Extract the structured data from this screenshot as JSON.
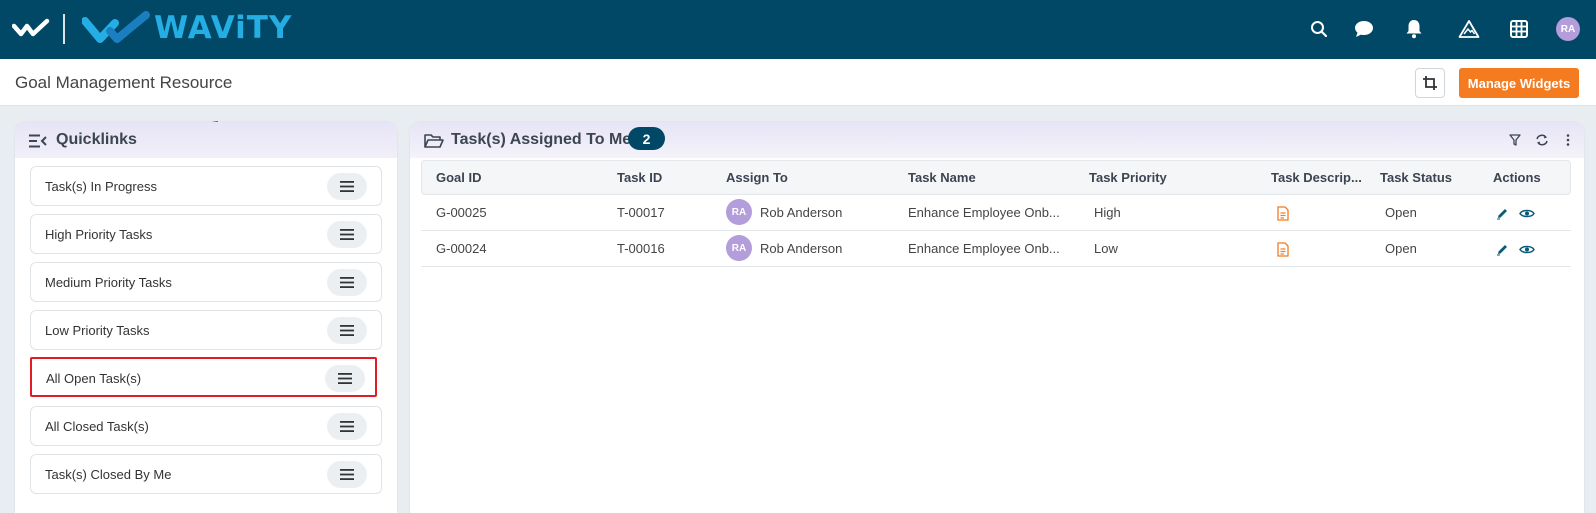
{
  "brand": {
    "name": "WAViTY"
  },
  "header": {
    "user_initials": "RA"
  },
  "page": {
    "title": "Goal Management Resource",
    "manage_widgets_label": "Manage Widgets"
  },
  "quicklinks": {
    "title": "Quicklinks",
    "items": [
      {
        "label": "Task(s) In Progress"
      },
      {
        "label": "High Priority Tasks"
      },
      {
        "label": "Medium Priority Tasks"
      },
      {
        "label": "Low Priority Tasks"
      },
      {
        "label": "All Open Task(s)"
      },
      {
        "label": "All Closed Task(s)"
      },
      {
        "label": "Task(s) Closed By Me"
      }
    ]
  },
  "tasks": {
    "title": "Task(s) Assigned To Me",
    "count": "2",
    "columns": [
      "Goal ID",
      "Task ID",
      "Assign To",
      "Task Name",
      "Task Priority",
      "Task Descrip...",
      "Task Status",
      "Actions"
    ],
    "rows": [
      {
        "goal_id": "G-00025",
        "task_id": "T-00017",
        "assignee_initials": "RA",
        "assignee": "Rob Anderson",
        "task_name": "Enhance Employee Onb...",
        "priority": "High",
        "status": "Open"
      },
      {
        "goal_id": "G-00024",
        "task_id": "T-00016",
        "assignee_initials": "RA",
        "assignee": "Rob Anderson",
        "task_name": "Enhance Employee Onb...",
        "priority": "Low",
        "status": "Open"
      }
    ]
  },
  "colors": {
    "topbar": "#014766",
    "brand": "#25aee4",
    "accent": "#f47b20",
    "highlight": "#e31b23"
  }
}
